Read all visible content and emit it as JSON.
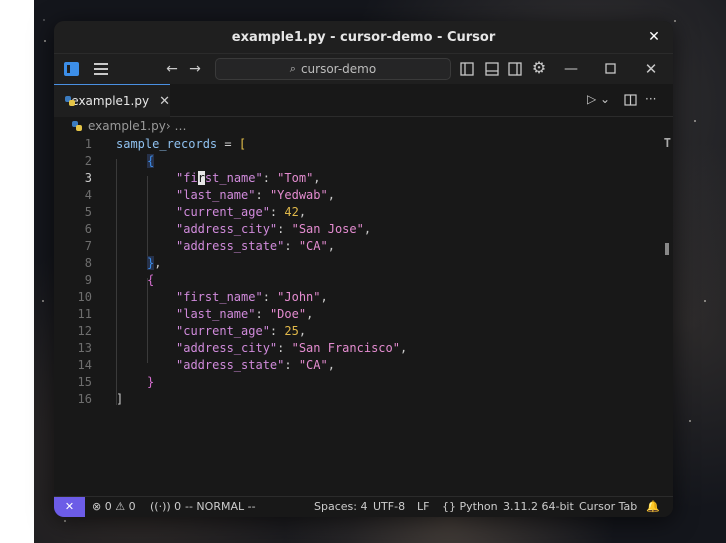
{
  "window": {
    "title": "example1.py - cursor-demo - Cursor",
    "close_glyph": "✕"
  },
  "toolbar": {
    "back_icon": "←",
    "forward_icon": "→",
    "search_text": "cursor-demo",
    "icons": [
      "toggle-primary-sidebar-icon",
      "toggle-panel-icon",
      "toggle-secondary-sidebar-icon",
      "gear-icon",
      "minimize-icon",
      "maximize-icon",
      "close-icon"
    ]
  },
  "tabs": [
    {
      "label": "example1.py",
      "close": "✕"
    }
  ],
  "breadcrumb": {
    "file": "example1.py",
    "sep": " › …"
  },
  "editor": {
    "line_numbers": [
      "1",
      "2",
      "3",
      "4",
      "5",
      "6",
      "7",
      "8",
      "9",
      "10",
      "11",
      "12",
      "13",
      "14",
      "15",
      "16"
    ],
    "active_line": "3",
    "lines": {
      "l1": {
        "var": "sample_records",
        "op": " = ",
        "br": "["
      },
      "l2": {
        "br": "{"
      },
      "l3": {
        "k1": "\"fi",
        "cur": "r",
        "k2": "st_name\"",
        "colon": ": ",
        "val": "\"Tom\"",
        "comma": ","
      },
      "l4": {
        "key": "\"last_name\"",
        "colon": ": ",
        "val": "\"Yedwab\"",
        "comma": ","
      },
      "l5": {
        "key": "\"current_age\"",
        "colon": ": ",
        "val": "42",
        "comma": ","
      },
      "l6": {
        "key": "\"address_city\"",
        "colon": ": ",
        "val": "\"San Jose\"",
        "comma": ","
      },
      "l7": {
        "key": "\"address_state\"",
        "colon": ": ",
        "val": "\"CA\"",
        "comma": ","
      },
      "l8": {
        "br": "}",
        "comma": ","
      },
      "l9": {
        "br": "{"
      },
      "l10": {
        "key": "\"first_name\"",
        "colon": ": ",
        "val": "\"John\"",
        "comma": ","
      },
      "l11": {
        "key": "\"last_name\"",
        "colon": ": ",
        "val": "\"Doe\"",
        "comma": ","
      },
      "l12": {
        "key": "\"current_age\"",
        "colon": ": ",
        "val": "25",
        "comma": ","
      },
      "l13": {
        "key": "\"address_city\"",
        "colon": ": ",
        "val": "\"San Francisco\"",
        "comma": ","
      },
      "l14": {
        "key": "\"address_state\"",
        "colon": ": ",
        "val": "\"CA\"",
        "comma": ","
      },
      "l15": {
        "br": "}"
      },
      "l16": {
        "br": "]"
      }
    }
  },
  "statusbar": {
    "remote_icon": "✕",
    "errors": "⊗ 0 ⚠ 0",
    "ports": "((·)) 0",
    "mode": "-- NORMAL --",
    "spaces": "Spaces: 4",
    "encoding": "UTF-8",
    "eol": "LF",
    "language": "{} Python",
    "interpreter": "3.11.2 64-bit",
    "cursor_tab": "Cursor Tab",
    "bell": "🔔"
  },
  "colors": {
    "accent": "#6c5ce7",
    "string": "#e48cd0",
    "number": "#e0b84a",
    "variable": "#8fc1f0"
  }
}
